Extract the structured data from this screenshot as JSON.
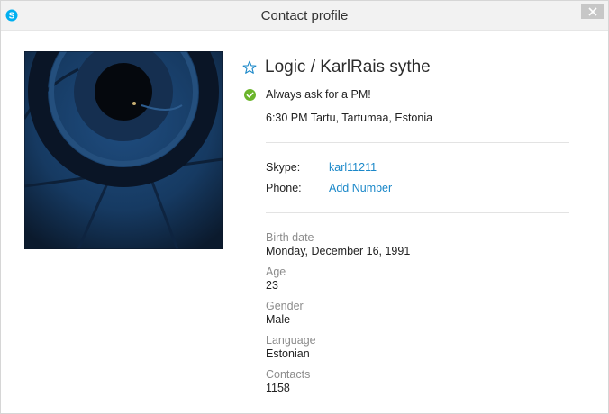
{
  "window": {
    "title": "Contact profile",
    "app_icon": "skype-icon",
    "close_icon": "close-icon"
  },
  "profile": {
    "avatar": "profile-picture",
    "name": "Logic /  KarlRais sythe",
    "favorite_icon": "star-outline-icon",
    "status_icon": "online-check-icon",
    "mood": "Always ask for a PM!",
    "local_time": "6:30 PM Tartu, Tartumaa, Estonia"
  },
  "contact": {
    "skype_label": "Skype:",
    "skype_value": "karl11211",
    "phone_label": "Phone:",
    "phone_value": "Add Number"
  },
  "details": {
    "birth_label": "Birth date",
    "birth_value": "Monday, December 16, 1991",
    "age_label": "Age",
    "age_value": "23",
    "gender_label": "Gender",
    "gender_value": "Male",
    "language_label": "Language",
    "language_value": "Estonian",
    "contacts_label": "Contacts",
    "contacts_value": "1158"
  },
  "colors": {
    "link": "#1b88c9",
    "status_green": "#6bb52b",
    "skype_blue": "#00aff0",
    "muted_label": "#8c8c8c"
  }
}
